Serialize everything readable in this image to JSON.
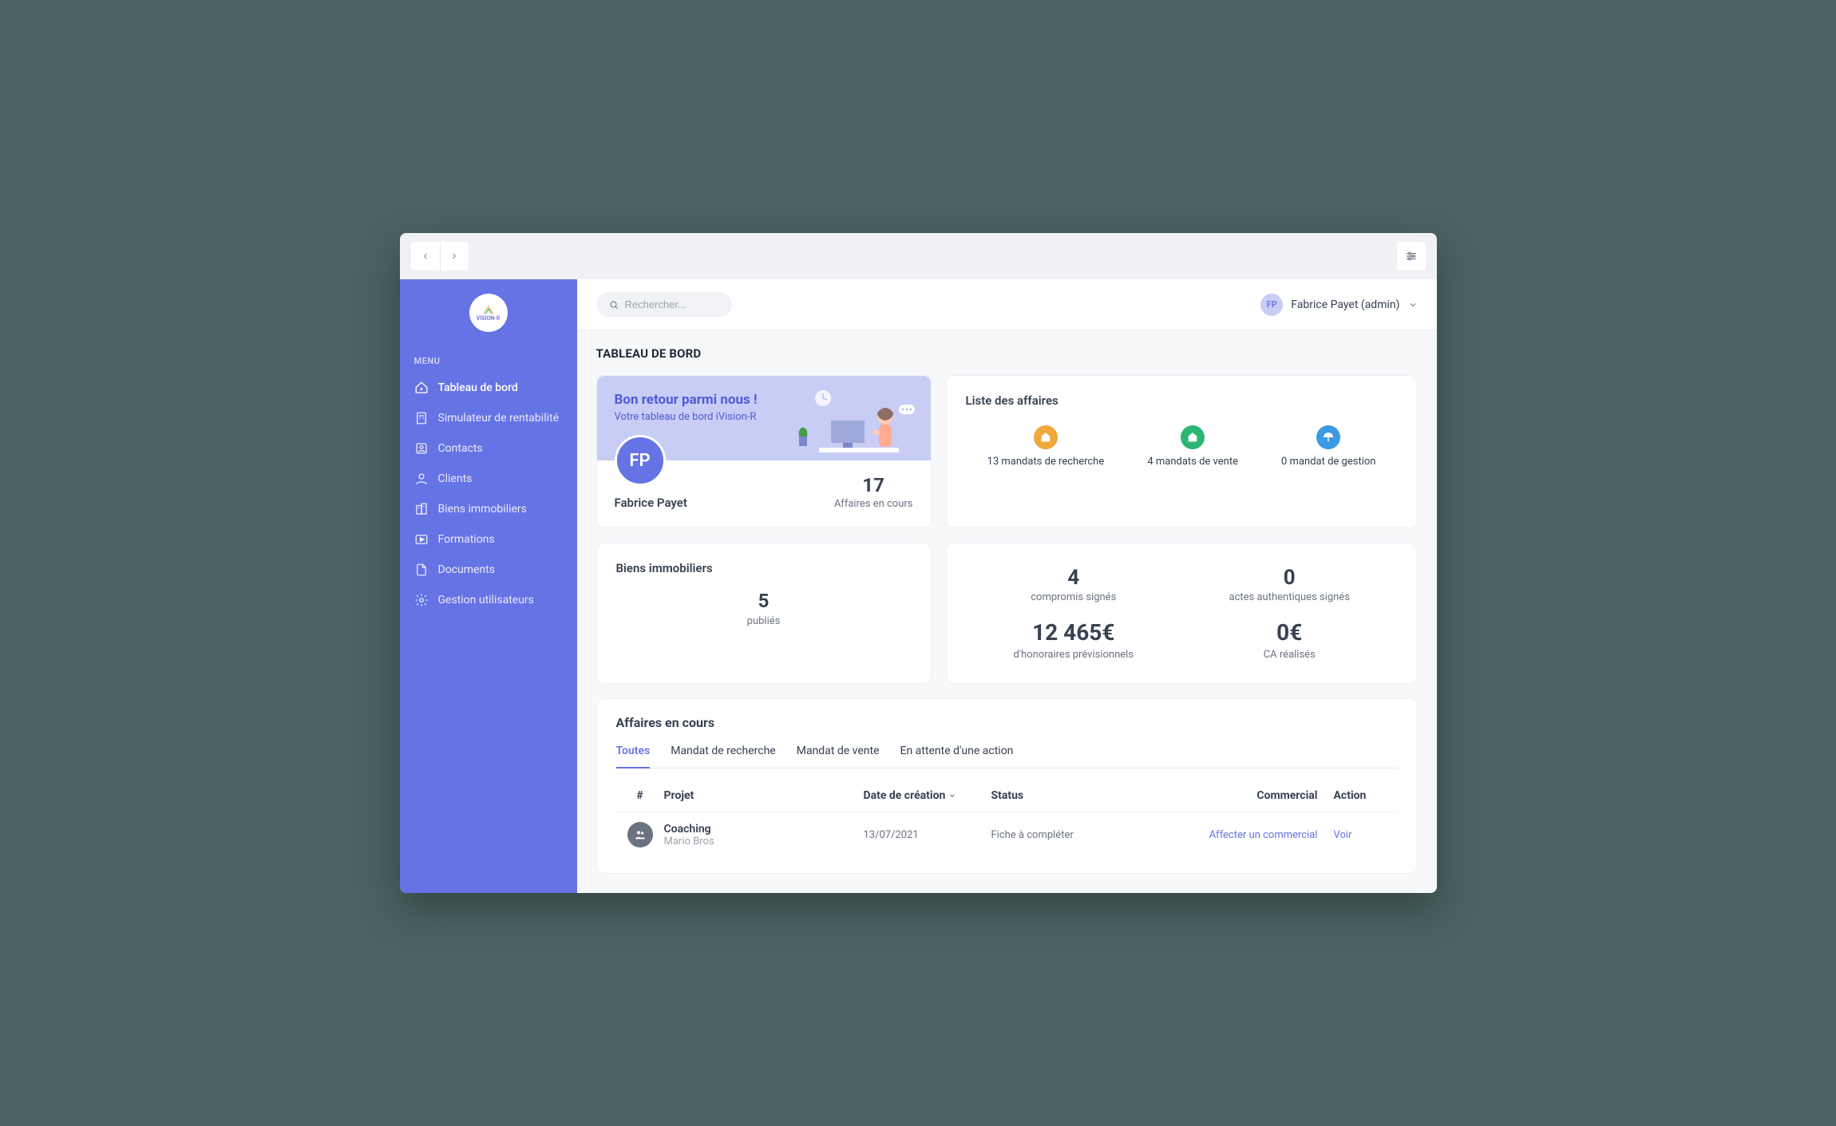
{
  "titlebar": {},
  "sidebar": {
    "logo_text": "VISION-R",
    "menu_label": "MENU",
    "items": [
      {
        "label": "Tableau de bord",
        "active": true
      },
      {
        "label": "Simulateur de rentabilité",
        "active": false
      },
      {
        "label": "Contacts",
        "active": false
      },
      {
        "label": "Clients",
        "active": false
      },
      {
        "label": "Biens immobiliers",
        "active": false
      },
      {
        "label": "Formations",
        "active": false
      },
      {
        "label": "Documents",
        "active": false
      },
      {
        "label": "Gestion utilisateurs",
        "active": false
      }
    ]
  },
  "topbar": {
    "search_placeholder": "Rechercher...",
    "user": {
      "initials": "FP",
      "name": "Fabrice Payet (admin)"
    }
  },
  "page": {
    "title": "TABLEAU DE BORD"
  },
  "welcome": {
    "heading": "Bon retour parmi nous !",
    "subheading": "Votre tableau de bord iVision-R",
    "avatar_initials": "FP",
    "user_name": "Fabrice Payet",
    "affaires_count": "17",
    "affaires_label": "Affaires en cours"
  },
  "mandats": {
    "title": "Liste des affaires",
    "items": [
      {
        "label": "13 mandats de recherche",
        "color": "orange"
      },
      {
        "label": "4 mandats de vente",
        "color": "green"
      },
      {
        "label": "0 mandat de gestion",
        "color": "blue"
      }
    ]
  },
  "biens": {
    "title": "Biens immobiliers",
    "count": "5",
    "label": "publiés"
  },
  "stats": {
    "left": {
      "big": "4",
      "sub": "compromis signés",
      "big2": "12 465€",
      "sub2": "d'honoraires prévisionnels"
    },
    "right": {
      "big": "0",
      "sub": "actes authentiques signés",
      "big2": "0€",
      "sub2": "CA réalisés"
    }
  },
  "affaires_table": {
    "title": "Affaires en cours",
    "tabs": [
      "Toutes",
      "Mandat de recherche",
      "Mandat de vente",
      "En attente d'une action"
    ],
    "headers": {
      "hash": "#",
      "projet": "Projet",
      "date": "Date de création",
      "status": "Status",
      "commercial": "Commercial",
      "action": "Action"
    },
    "rows": [
      {
        "projet": "Coaching",
        "sous": "Mario Bros",
        "date": "13/07/2021",
        "status": "Fiche à compléter",
        "commercial": "Affecter un commercial",
        "action": "Voir"
      }
    ]
  }
}
